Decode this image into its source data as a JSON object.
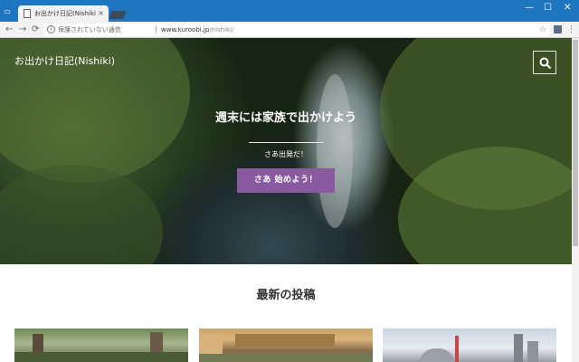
{
  "browser": {
    "tab_title": "お出かけ日記(Nishiki) | 週",
    "tab_close": "×",
    "security_label": "保護されていない通信",
    "url_domain": "www.kuroobi.jp",
    "url_path": "/nishiki/",
    "nav": {
      "back": "←",
      "forward": "→",
      "reload": "⟳"
    },
    "window_controls": {
      "minimize": "—",
      "maximize": "☐",
      "close": "✕"
    },
    "star": "☆",
    "menu": "⋮"
  },
  "site": {
    "title": "お出かけ日記(Nishiki)"
  },
  "hero": {
    "heading": "週末には家族で出かけよう",
    "subheading": "さあ出発だ！",
    "cta_label": "さあ 始めよう！"
  },
  "sections": {
    "latest_posts_title": "最新の投稿"
  },
  "colors": {
    "accent": "#8a5aa0",
    "titlebar": "#1f76c0"
  }
}
